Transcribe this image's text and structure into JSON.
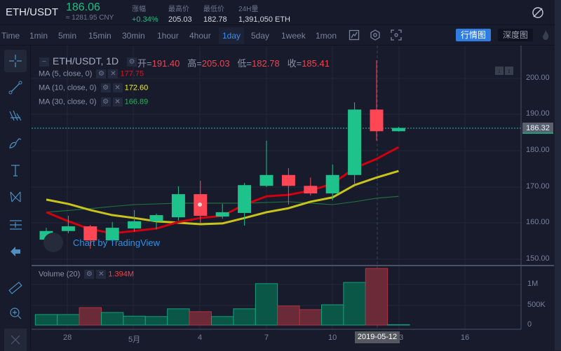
{
  "header": {
    "pair": "ETH/USDT",
    "last_price": "186.06",
    "cny": "≈ 1281.95 CNY",
    "stats": [
      {
        "label": "涨幅",
        "value": "+0.34%"
      },
      {
        "label": "最高价",
        "value": "205.03"
      },
      {
        "label": "最低价",
        "value": "182.78"
      },
      {
        "label": "24H量",
        "value": "1,391,050 ETH"
      }
    ]
  },
  "toolbar": {
    "intervals": [
      "Time",
      "1min",
      "5min",
      "15min",
      "30min",
      "1hour",
      "4hour",
      "1day",
      "5day",
      "1week",
      "1mon"
    ],
    "active_interval": "1day",
    "kline_button": "行情图",
    "depth_button": "深度图"
  },
  "legend": {
    "title": "ETH/USDT, 1D",
    "open_label": "开=",
    "open": "191.40",
    "high_label": "高=",
    "high": "205.03",
    "low_label": "低=",
    "low": "182.78",
    "close_label": "收=",
    "close": "185.41",
    "ma5_label": "MA (5, close, 0)",
    "ma5_value": "177.75",
    "ma10_label": "MA (10, close, 0)",
    "ma10_value": "172.60",
    "ma30_label": "MA (30, close, 0)",
    "ma30_value": "166.89",
    "volume_label": "Volume (20)",
    "volume_value": "1.394M"
  },
  "watermark": "Chart by TradingView",
  "price_axis": [
    "200.00",
    "190.00",
    "180.00",
    "170.00",
    "160.00",
    "150.00"
  ],
  "current_price_tag": "186.32",
  "volume_axis": [
    "1M",
    "500K",
    "0"
  ],
  "time_axis": [
    "28",
    "5月",
    "4",
    "7",
    "10",
    "13",
    "16"
  ],
  "crosshair_date": "2019-05-12",
  "colors": {
    "up": "#1ec28b",
    "down": "#ff4654",
    "ma5": "#d0000f",
    "ma10": "#c8c41a",
    "ma30": "#1f6e3c",
    "accent": "#2f7de1"
  },
  "chart_data": {
    "type": "candlestick",
    "price_range": [
      150,
      205
    ],
    "candles": [
      {
        "o": 155.4,
        "h": 158.7,
        "l": 154.6,
        "c": 157.8
      },
      {
        "o": 157.8,
        "h": 162.0,
        "l": 157.2,
        "c": 159.1
      },
      {
        "o": 159.1,
        "h": 159.5,
        "l": 152.9,
        "c": 155.2
      },
      {
        "o": 155.2,
        "h": 160.3,
        "l": 154.8,
        "c": 158.7
      },
      {
        "o": 158.5,
        "h": 163.6,
        "l": 157.6,
        "c": 160.5
      },
      {
        "o": 160.5,
        "h": 162.6,
        "l": 158.3,
        "c": 162.2
      },
      {
        "o": 161.6,
        "h": 170.2,
        "l": 160.7,
        "c": 168.0
      },
      {
        "o": 168.0,
        "h": 171.7,
        "l": 160.0,
        "c": 162.0
      },
      {
        "o": 161.8,
        "h": 165.3,
        "l": 161.2,
        "c": 163.0
      },
      {
        "o": 162.8,
        "h": 171.1,
        "l": 159.3,
        "c": 170.5
      },
      {
        "o": 170.3,
        "h": 182.8,
        "l": 170.0,
        "c": 173.3
      },
      {
        "o": 173.3,
        "h": 175.2,
        "l": 165.1,
        "c": 170.3
      },
      {
        "o": 170.3,
        "h": 172.6,
        "l": 167.6,
        "c": 168.2
      },
      {
        "o": 168.2,
        "h": 176.2,
        "l": 166.3,
        "c": 173.3
      },
      {
        "o": 173.3,
        "h": 193.4,
        "l": 170.9,
        "c": 191.4
      },
      {
        "o": 191.4,
        "h": 205.03,
        "l": 182.78,
        "c": 185.41
      },
      {
        "o": 185.41,
        "h": 186.6,
        "l": 185.3,
        "c": 186.32
      }
    ],
    "ma5": [
      163.0,
      160.5,
      158.3,
      157.2,
      157.8,
      158.5,
      160.3,
      161.4,
      162.0,
      165.1,
      167.4,
      167.8,
      169.0,
      170.9,
      175.2,
      177.75,
      181.0
    ],
    "ma10": [
      166.5,
      165.3,
      163.6,
      162.2,
      161.4,
      160.5,
      160.1,
      159.7,
      159.9,
      161.4,
      163.0,
      164.1,
      165.9,
      167.1,
      170.5,
      172.6,
      174.4
    ],
    "ma30": [
      163.0,
      163.5,
      164.0,
      164.6,
      165.1,
      165.3,
      165.5,
      165.5,
      165.5,
      165.5,
      165.7,
      165.9,
      165.5,
      165.1,
      165.9,
      166.89,
      167.4
    ],
    "volume_millions": [
      0.26,
      0.26,
      0.43,
      0.31,
      0.22,
      0.21,
      0.4,
      0.33,
      0.21,
      0.4,
      1.02,
      0.47,
      0.38,
      0.5,
      1.05,
      1.394,
      0.01
    ],
    "volume_range": [
      0,
      1.4
    ]
  }
}
